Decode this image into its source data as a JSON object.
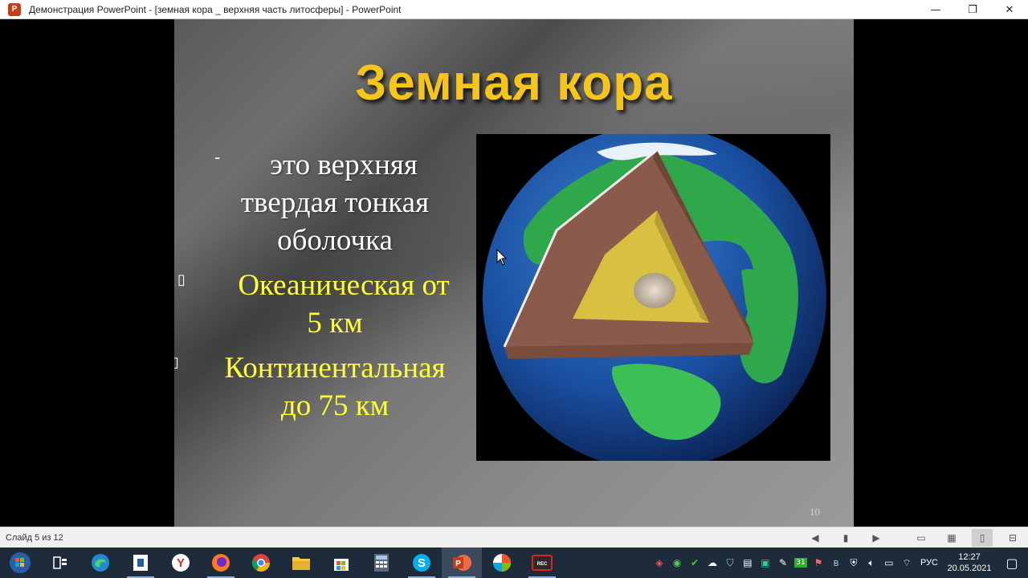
{
  "window": {
    "title": "Демонстрация PowerPoint - [земная кора _ верхняя часть литосферы] - PowerPoint",
    "app_icon_letter": "P",
    "minimize": "—",
    "restore": "❐",
    "close": "✕"
  },
  "slide": {
    "title": "Земная кора",
    "definition_marker": "-",
    "definition": [
      "это верхняя",
      "твердая тонкая",
      "оболочка"
    ],
    "bullets": [
      {
        "marker": "▯",
        "lines": [
          "Океаническая от",
          "5 км"
        ]
      },
      {
        "marker": "▯",
        "lines": [
          "Континентальная",
          "до 75 км"
        ]
      }
    ],
    "number": "10",
    "image": "earth-cross-section"
  },
  "statusbar": {
    "slide_counter": "Слайд 5 из 12",
    "icons": [
      "prev-slide-icon",
      "slide-sorter-thumb-icon",
      "next-slide-icon",
      "normal-view-icon",
      "slide-sorter-icon",
      "reading-view-icon",
      "slideshow-icon"
    ]
  },
  "taskbar": {
    "apps": [
      "task-view",
      "edge",
      "vpn-app",
      "yandex",
      "firefox",
      "chrome",
      "file-explorer",
      "store",
      "calculator",
      "skype",
      "powerpoint",
      "photos",
      "recorder"
    ],
    "tray_lang": "РУС",
    "time": "12:27",
    "date": "20.05.2021",
    "calendar_badge": "31"
  },
  "colors": {
    "title": "#f5c518",
    "definition_text": "#ffffff",
    "bullet_text": "#ffff33",
    "taskbar": "#1e2b3a"
  }
}
